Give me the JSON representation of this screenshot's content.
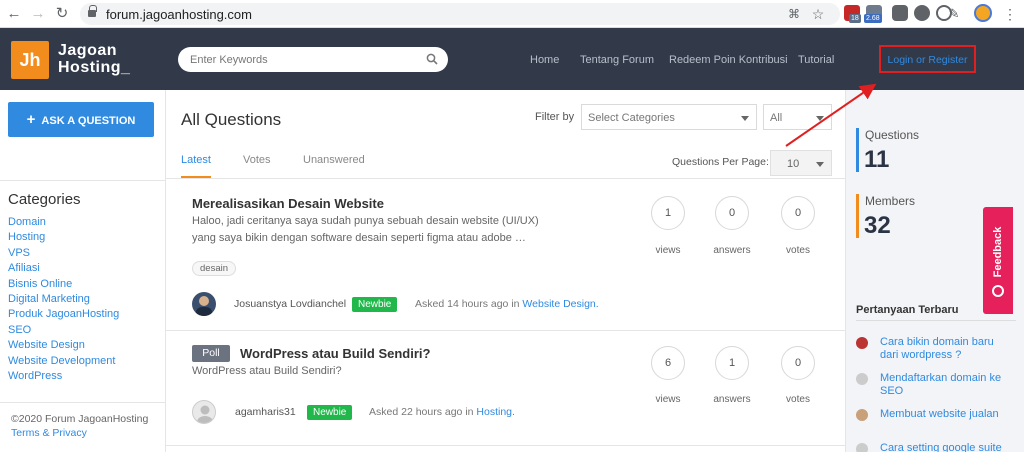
{
  "browser": {
    "url": "forum.jagoanhosting.com",
    "ext_badge_1": "18",
    "ext_badge_2": "2.68"
  },
  "header": {
    "logo_mark": "Jh",
    "logo_line1": "Jagoan",
    "logo_line2": "Hosting_",
    "search_placeholder": "Enter Keywords",
    "menu": [
      "Home",
      "Tentang Forum",
      "Redeem Poin Kontribusi",
      "Tutorial"
    ],
    "login_label": "Login or Register"
  },
  "left_sidebar": {
    "ask_button": "ASK A QUESTION",
    "categories_title": "Categories",
    "categories": [
      "Domain",
      "Hosting",
      "VPS",
      "Afiliasi",
      "Bisnis Online",
      "Digital Marketing",
      "Produk JagoanHosting",
      "SEO",
      "Website Design",
      "Website Development",
      "WordPress"
    ],
    "copyright": "©2020 Forum JagoanHosting",
    "terms": "Terms & Privacy"
  },
  "main": {
    "title": "All Questions",
    "filter_label": "Filter by",
    "category_select": "Select Categories",
    "all_select": "All",
    "tabs": [
      "Latest",
      "Votes",
      "Unanswered"
    ],
    "qpp_label": "Questions Per Page:",
    "qpp_value": "10",
    "questions": [
      {
        "title": "Merealisasikan Desain Website",
        "excerpt": "Haloo, jadi ceritanya saya sudah punya sebuah desain website (UI/UX) yang saya bikin dengan software desain seperti figma atau adobe …",
        "tag": "desain",
        "author": "Josuanstya Lovdianchel",
        "badge": "Newbie",
        "asked": "Asked 14 hours ago in",
        "category": "Website Design.",
        "views": "1",
        "answers": "0",
        "votes": "0"
      },
      {
        "poll": "Poll",
        "title": "WordPress atau Build Sendiri?",
        "excerpt": "WordPress atau Build Sendiri?",
        "author": "agamharis31",
        "badge": "Newbie",
        "asked": "Asked 22 hours ago in",
        "category": "Hosting.",
        "views": "6",
        "answers": "1",
        "votes": "0"
      }
    ],
    "stat_labels": [
      "views",
      "answers",
      "votes"
    ]
  },
  "right_sidebar": {
    "questions_label": "Questions",
    "questions_count": "11",
    "members_label": "Members",
    "members_count": "32",
    "feedback": "Feedback",
    "recent_title": "Pertanyaan Terbaru",
    "recent": [
      "Cara bikin domain baru dari wordpress ?",
      "Mendaftarkan domain ke SEO",
      "Membuat website jualan",
      "Cara setting google suite"
    ]
  },
  "colors": {
    "accent": "#2f8ae0",
    "brand_orange": "#f28c1c",
    "header_bg": "#323a4a",
    "newbie_green": "#20b84a",
    "feedback_pink": "#e6205a",
    "annotation_red": "#e02020"
  }
}
